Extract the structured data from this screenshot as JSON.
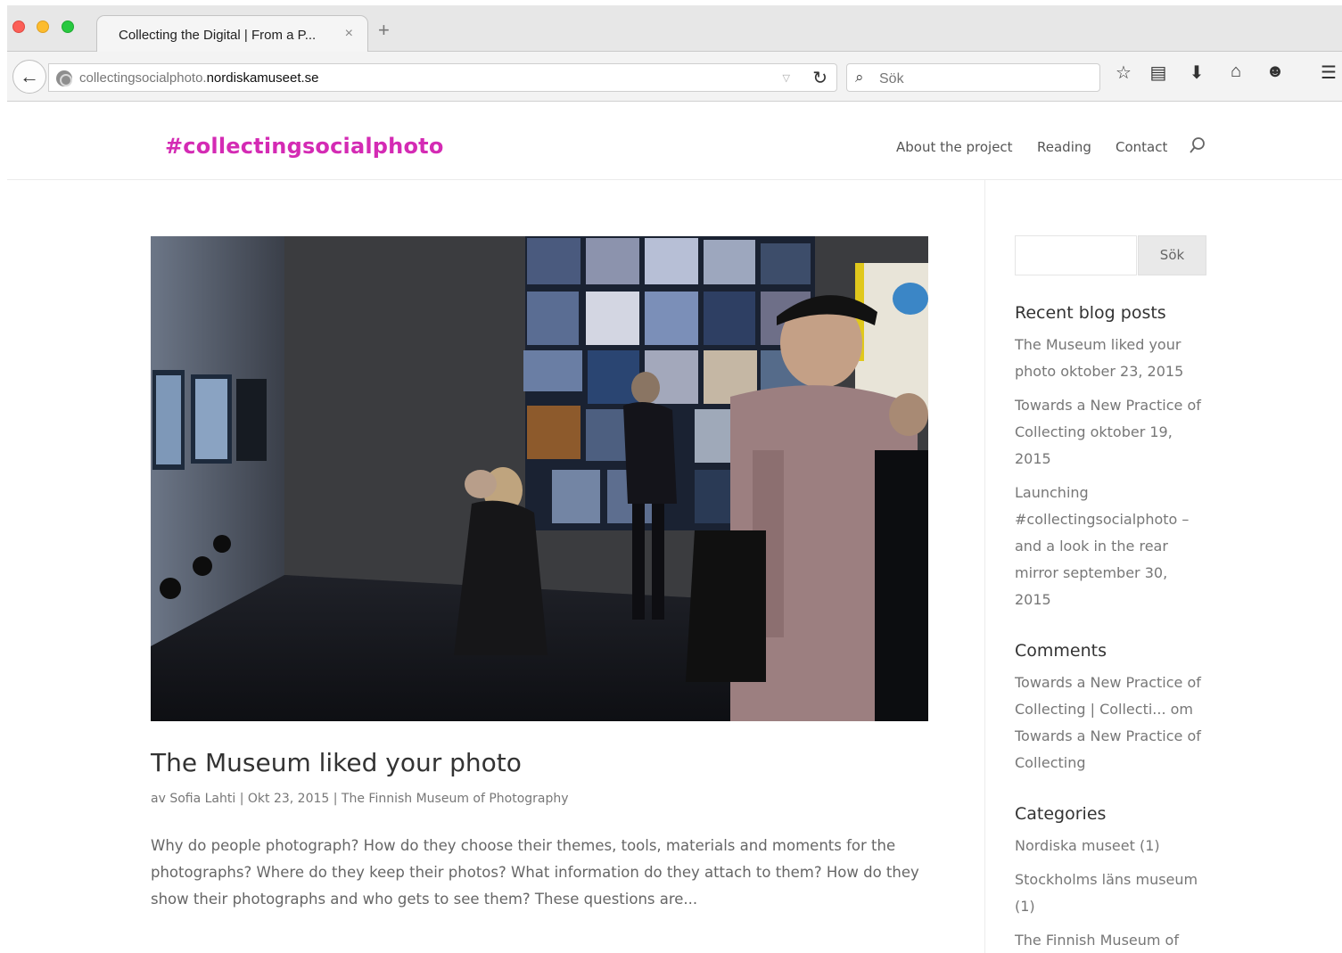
{
  "browser": {
    "tab_title": "Collecting the Digital | From a P...",
    "tab_close": "×",
    "new_tab": "+",
    "url_prefix": "collectingsocialphoto.",
    "url_domain": "nordiskamuseet.se",
    "search_placeholder": "Sök"
  },
  "site": {
    "logo": "#collectingsocialphoto",
    "nav": [
      "About the project",
      "Reading",
      "Contact"
    ],
    "accent_color": "#d42bb4"
  },
  "post": {
    "title": "The Museum liked your photo",
    "meta_author": "av Sofia Lahti",
    "meta_sep": "|",
    "meta_date": "Okt 23, 2015",
    "meta_category": "The Finnish Museum of Photography",
    "excerpt": "Why do people photograph? How do they choose their themes, tools, materials and moments for the photographs? Where do they keep their photos? What information do they attach to them? How do they show their photographs and who gets to see them? These questions are..."
  },
  "sidebar": {
    "search_button": "Sök",
    "recent_title": "Recent blog posts",
    "recent": [
      "The Museum liked your photo oktober 23, 2015",
      "Towards a New Practice of Collecting oktober 19, 2015",
      "Launching #collectingsocialphoto – and a look in the rear mirror september 30, 2015"
    ],
    "comments_title": "Comments",
    "comments": [
      "Towards a New Practice of Collecting | Collecti... om Towards a New Practice of Collecting"
    ],
    "categories_title": "Categories",
    "categories": [
      "Nordiska museet (1)",
      "Stockholms läns museum (1)",
      "The Finnish Museum of"
    ]
  }
}
